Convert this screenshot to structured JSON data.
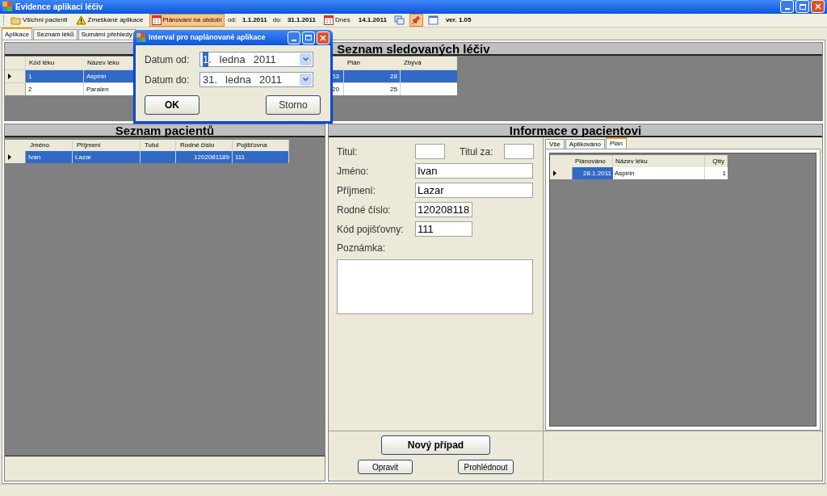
{
  "window": {
    "title": "Evidence aplikací léčiv"
  },
  "toolbar": [
    {
      "kind": "button",
      "label": "Všichni pacienti",
      "selected": false
    },
    {
      "kind": "button",
      "label": "Zmeškané aplikace",
      "selected": false
    },
    {
      "kind": "button",
      "label": "Plánovaní na období",
      "selected": true
    },
    {
      "kind": "text",
      "label": "od:"
    },
    {
      "kind": "value",
      "label": "1.1.2011"
    },
    {
      "kind": "text",
      "label": "do:"
    },
    {
      "kind": "value",
      "label": "31.1.2011"
    },
    {
      "kind": "button",
      "label": "Dnes",
      "selected": false
    },
    {
      "kind": "value",
      "label": "14.1.2011"
    },
    {
      "kind": "icon-button",
      "selected": false
    },
    {
      "kind": "icon-button",
      "selected": true
    },
    {
      "kind": "icon-button",
      "selected": false
    },
    {
      "kind": "value",
      "label": "ver. 1.05"
    }
  ],
  "tabs": [
    {
      "label": "Aplikace",
      "selected": true
    },
    {
      "label": "Seznam léků",
      "selected": false
    },
    {
      "label": "Sumární přehledy",
      "selected": false
    }
  ],
  "drugs": {
    "title": "Seznam sledovaných léčiv",
    "columns": {
      "code": "Kód léku",
      "name": "Název léku",
      "plan": "Plán",
      "remaining": "Zbývá"
    },
    "rows": [
      {
        "code": "1",
        "name": "Aspirin",
        "column_3": "53",
        "plan": "28",
        "selected": true
      },
      {
        "code": "2",
        "name": "Paralen",
        "column_3": "20",
        "plan": "25",
        "selected": false
      }
    ]
  },
  "patients": {
    "title": "Seznam pacientů",
    "columns": [
      "Jméno",
      "Příjmení",
      "Tutul",
      "Rodné číslo",
      "Pojišťovna"
    ],
    "rows": [
      {
        "cells": [
          "Ivan",
          "Lazar",
          "",
          "1202081189",
          "111"
        ],
        "selected": true
      }
    ]
  },
  "patient_info": {
    "title": "Informace o pacientovi",
    "title_field": {
      "label": "Titul:"
    },
    "title_after_field": {
      "label": "Titul za:"
    },
    "fields": [
      {
        "label": "Jméno:",
        "value": "Ivan"
      },
      {
        "label": "Příjmení:",
        "value": "Lazar"
      },
      {
        "label": "Rodné číslo:",
        "value": "120208118"
      },
      {
        "label": "Kód pojišťovny:",
        "value": "111"
      }
    ],
    "note": {
      "label": "Poznámka:"
    },
    "tabs": [
      {
        "label": "Vše",
        "selected": false
      },
      {
        "label": "Aplikováno",
        "selected": false
      },
      {
        "label": "Plán",
        "selected": true
      }
    ],
    "plan_table": {
      "columns": [
        "Plánováno",
        "Název léku",
        "Qtty"
      ],
      "rows": [
        {
          "date": "28.1.2011",
          "name": "Aspirin",
          "qty": "1",
          "selected": true
        }
      ]
    },
    "new_case_button": "Nový případ",
    "edit_button": "Opravit",
    "view_button": "Prohlédnout"
  },
  "dialog": {
    "title": "Interval pro naplánované aplikace",
    "fields": [
      {
        "label": "Datum od:",
        "day": "1",
        "day_selected": true,
        "dot": ".",
        "month": "ledna",
        "year": "2011"
      },
      {
        "label": "Datum do:",
        "day": "31",
        "day_selected": false,
        "dot": ".",
        "month": "ledna",
        "year": "2011"
      }
    ],
    "ok": "OK",
    "cancel": "Storno"
  }
}
